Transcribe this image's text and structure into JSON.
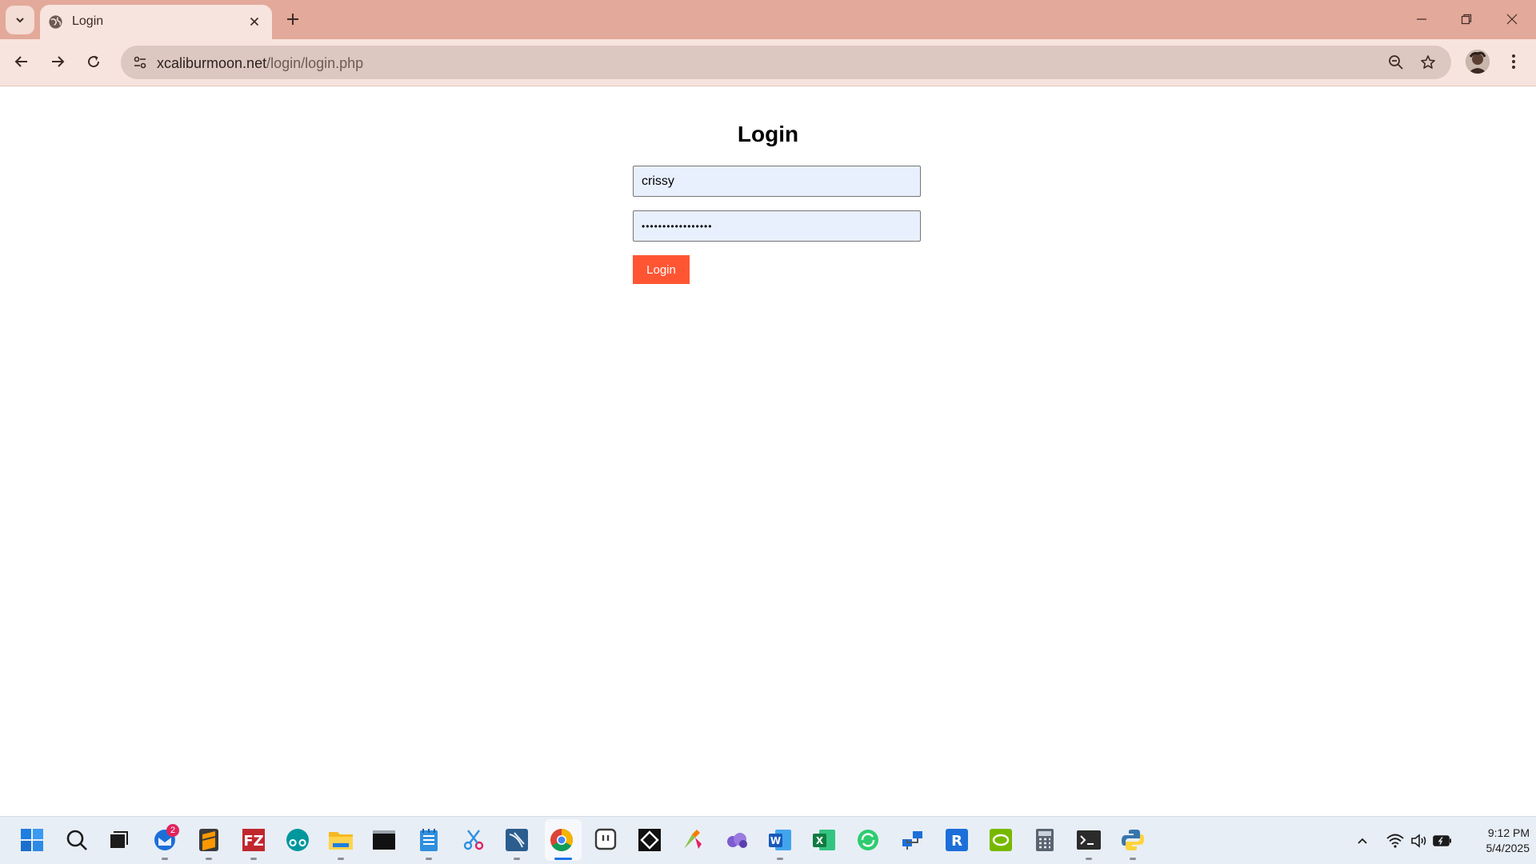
{
  "browser": {
    "tab_title": "Login",
    "url_host": "xcaliburmoon.net",
    "url_path": "/login/login.php"
  },
  "page": {
    "title": "Login",
    "username_value": "crissy",
    "password_masked": "•••••••••••••••••",
    "login_button": "Login"
  },
  "taskbar": {
    "mail_badge": "2",
    "time": "9:12 PM",
    "date": "5/4/2025"
  },
  "colors": {
    "tabbar": "#e3a99a",
    "toolbar": "#f7e4de",
    "login_button": "#ff5533",
    "autofill_field": "#e8f0fe"
  }
}
